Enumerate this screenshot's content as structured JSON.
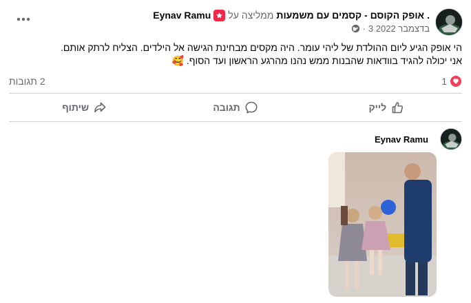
{
  "post": {
    "author": "Eynav Ramu",
    "recommends_text": "ממליצה על",
    "page_name": "אופק הקוסם - קסמים עם משמעות",
    "period": ".",
    "date": "3 בדצמבר 2022",
    "date_separator": "·",
    "text_line1": "הי אופק הגיע ליום ההולדת של ליהי עומר. היה מקסים מבחינת הגישה אל הילדים. הצליח לרתק אותם.",
    "text_line2": "אני יכולה להגיד בוודאות שהבנות ממש נהנו מהרגע הראשון ועד הסוף.",
    "emoji": "🥰"
  },
  "stats": {
    "reactions_count": "1",
    "comments_count": "2 תגובות"
  },
  "actions": {
    "like": "לייק",
    "comment": "תגובה",
    "share": "שיתוף"
  },
  "comment": {
    "author": "Eynav Ramu"
  },
  "icons": {
    "more": "more-dots-icon",
    "recommend": "recommend-badge-icon",
    "globe": "globe-icon",
    "heart": "heart-reaction-icon",
    "like": "thumbs-up-icon",
    "comment": "comment-bubble-icon",
    "share": "share-arrow-icon"
  },
  "colors": {
    "recommend_red": "#f02849",
    "heart_red": "#f33e58",
    "muted_text": "#65676b",
    "divider": "#ced0d4"
  }
}
